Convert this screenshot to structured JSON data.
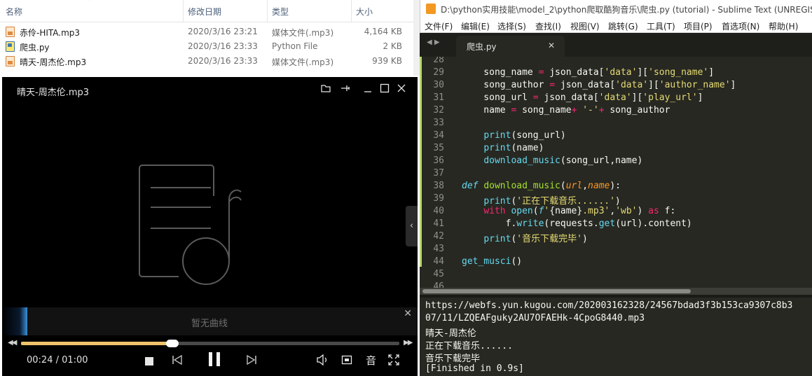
{
  "explorer": {
    "columns": {
      "name": "名称",
      "date": "修改日期",
      "type": "类型",
      "size": "大小"
    },
    "files": [
      {
        "name": "赤伶-HITA.mp3",
        "date": "2020/3/16 23:21",
        "type": "媒体文件(.mp3)",
        "size": "4,164 KB",
        "icon": "mp3-file-icon"
      },
      {
        "name": "爬虫.py",
        "date": "2020/3/16 23:33",
        "type": "Python File",
        "size": "2 KB",
        "icon": "python-file-icon"
      },
      {
        "name": "晴天-周杰伦.mp3",
        "date": "2020/3/16 23:33",
        "type": "媒体文件(.mp3)",
        "size": "939 KB",
        "icon": "mp3-file-icon"
      }
    ]
  },
  "player": {
    "title": "晴天-周杰伦.mp3",
    "no_curve_text": "暂无曲线",
    "time": "00:24 / 01:00",
    "progress": 0.4,
    "colors": {
      "progress": "#f0c36b",
      "accent": "#3a8fd9"
    },
    "subtitle_label": "音"
  },
  "sublime": {
    "title": "D:\\python实用技能\\model_2\\python爬取酷狗音乐\\爬虫.py (tutorial) - Sublime Text (UNREGISTERED)",
    "menu": [
      "文件(F)",
      "编辑(E)",
      "选择(S)",
      "查找(I)",
      "视图(V)",
      "跳转(G)",
      "工具(T)",
      "项目(P)",
      "首选项(N)",
      "帮助(H)"
    ],
    "tab": "爬虫.py",
    "line_numbers": [
      "28",
      "29",
      "30",
      "31",
      "32",
      "33",
      "34",
      "35",
      "36",
      "37",
      "38",
      "39",
      "40",
      "41",
      "42",
      "43",
      "44",
      "45",
      "46"
    ],
    "console": [
      "https://webfs.yun.kugou.com/202003162328/24567bdad3f3b153ca9307c8b3",
      "07/11/LZQEAFguky2AU7OFAEHk-4CpoG8440.mp3",
      "晴天-周杰伦",
      "正在下载音乐......",
      "音乐下载完毕",
      "[Finished in 0.9s]"
    ]
  }
}
